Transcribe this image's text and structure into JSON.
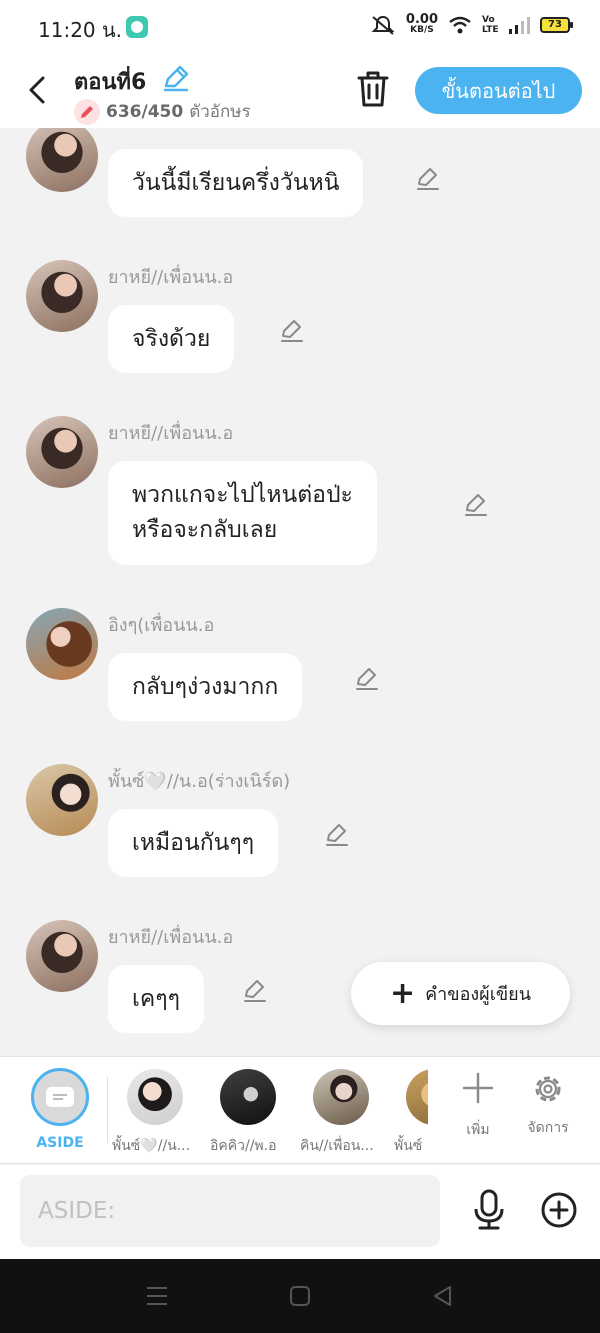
{
  "status_bar": {
    "time": "11:20 น.",
    "net_rate": "0.00",
    "net_unit": "KB/S",
    "volte": "Vo LTE",
    "battery": "73"
  },
  "header": {
    "title": "ตอนที่6",
    "char_count": "636/450",
    "char_count_suffix": "ตัวอักษร",
    "next_label": "ขั้นตอนต่อไป"
  },
  "messages": [
    {
      "sender": "",
      "text": "วันนี้มีเรียนครึ่งวันหนิ"
    },
    {
      "sender": "ยาหยี//เพื่อนน.อ",
      "text": "จริงด้วย"
    },
    {
      "sender": "ยาหยี//เพื่อนน.อ",
      "text": "พวกแกจะไปไหนต่อป่ะ\nหรือจะกลับเลย"
    },
    {
      "sender": "อิงๆ(เพื่อนน.อ",
      "text": "กลับๆง่วงมากก"
    },
    {
      "sender": "พั้นซ์🤍//น.อ(ร่างเนิร์ด)",
      "text": "เหมือนกันๆๆ"
    },
    {
      "sender": "ยาหยี//เพื่อนน.อ",
      "text": "เคๆๆ"
    }
  ],
  "fab": {
    "label": "คำของผู้เขียน"
  },
  "character_bar": {
    "aside_label": "ASIDE",
    "characters": [
      {
        "name": "พั้นซ์🤍//น..."
      },
      {
        "name": "อิคคิว//พ.อ"
      },
      {
        "name": "คิน//เพื่อน..."
      },
      {
        "name": "พั้นซ์"
      }
    ],
    "add_label": "เพิ่ม",
    "manage_label": "จัดการ"
  },
  "input": {
    "placeholder": "ASIDE:"
  },
  "colors": {
    "accent": "#4ab3f0",
    "background": "#f2f2f2"
  }
}
